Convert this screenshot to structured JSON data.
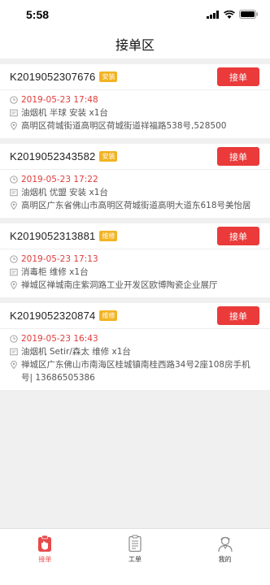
{
  "status": {
    "time": "5:58"
  },
  "nav": {
    "title": "接单区"
  },
  "orders": [
    {
      "id": "K2019052307676",
      "tag": "安装",
      "button": "接单",
      "time": "2019-05-23 17:48",
      "product": "油烟机  半球  安装  x1台",
      "address": "高明区荷城街道高明区荷城街道祥福路538号,528500"
    },
    {
      "id": "K2019052343582",
      "tag": "安装",
      "button": "接单",
      "time": "2019-05-23 17:22",
      "product": "油烟机  优盟  安装  x1台",
      "address": "高明区广东省佛山市高明区荷城街道高明大道东618号美怡居"
    },
    {
      "id": "K2019052313881",
      "tag": "维修",
      "button": "接单",
      "time": "2019-05-23 17:13",
      "product": "消毒柜    维修  x1台",
      "address": "禅城区禅城南庄紫洞路工业开发区欧博陶瓷企业展厅"
    },
    {
      "id": "K2019052320874",
      "tag": "维修",
      "button": "接单",
      "time": "2019-05-23 16:43",
      "product": "油烟机  Setir/森太  维修  x1台",
      "address": "禅城区广东佛山市南海区桂城镇南桂西路34号2座108房手机号|  13686505386"
    }
  ],
  "tabs": [
    {
      "label": "接单",
      "icon": "clipboard-hand-icon",
      "active": true
    },
    {
      "label": "工单",
      "icon": "document-list-icon",
      "active": false
    },
    {
      "label": "我的",
      "icon": "user-profile-icon",
      "active": false
    }
  ],
  "colors": {
    "accent": "#ea3a3a",
    "tag": "#f2b424",
    "time": "#e03c3c"
  }
}
